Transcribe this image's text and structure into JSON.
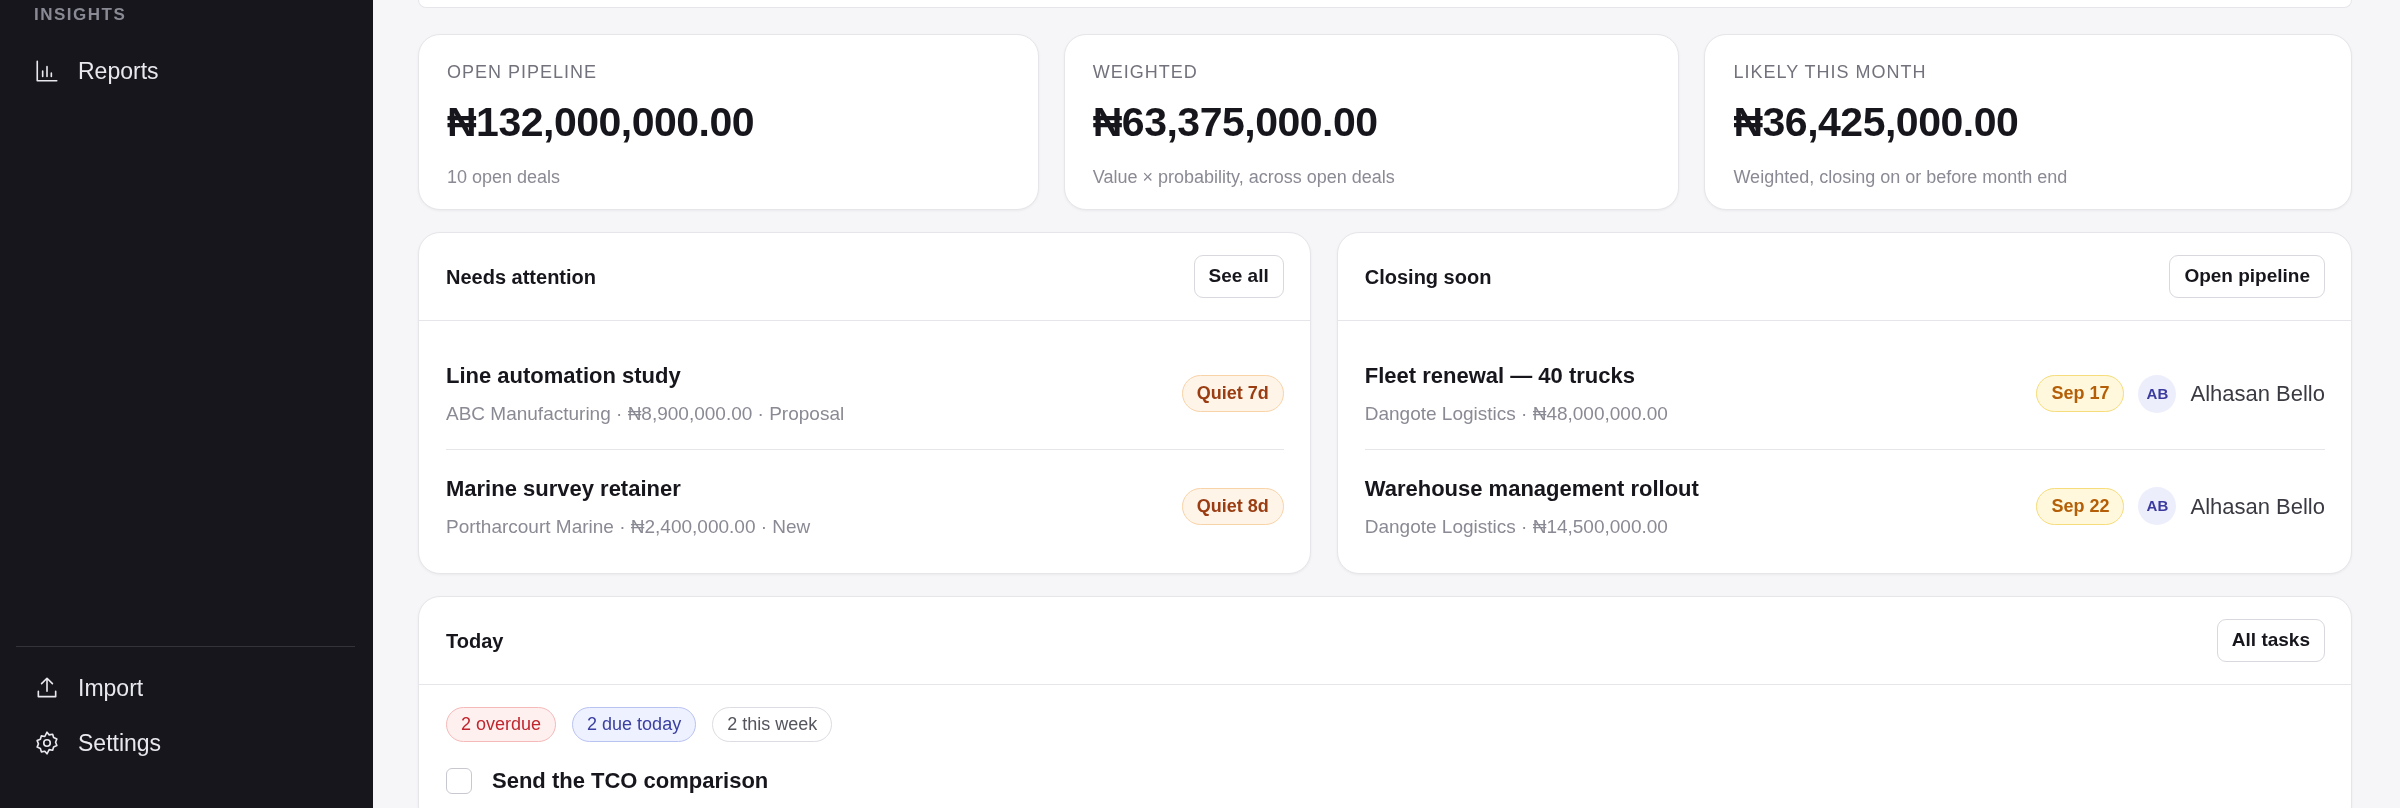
{
  "sidebar": {
    "section_label": "INSIGHTS",
    "items": [
      {
        "label": "Reports",
        "kind": "chart"
      }
    ],
    "footer_items": [
      {
        "label": "Import",
        "kind": "upload"
      },
      {
        "label": "Settings",
        "kind": "gear"
      }
    ]
  },
  "kpis": [
    {
      "label": "OPEN PIPELINE",
      "value": "₦132,000,000.00",
      "caption": "10 open deals"
    },
    {
      "label": "WEIGHTED",
      "value": "₦63,375,000.00",
      "caption": "Value × probability, across open deals"
    },
    {
      "label": "LIKELY THIS MONTH",
      "value": "₦36,425,000.00",
      "caption": "Weighted, closing on or before month end"
    }
  ],
  "needs_attention": {
    "title": "Needs attention",
    "button": "See all",
    "items": [
      {
        "title": "Line automation study",
        "meta": "ABC Manufacturing · ₦8,900,000.00 · Proposal",
        "badge": "Quiet 7d"
      },
      {
        "title": "Marine survey retainer",
        "meta": "Portharcourt Marine · ₦2,400,000.00 · New",
        "badge": "Quiet 8d"
      }
    ]
  },
  "closing_soon": {
    "title": "Closing soon",
    "button": "Open pipeline",
    "items": [
      {
        "title": "Fleet renewal — 40 trucks",
        "meta": "Dangote Logistics · ₦48,000,000.00",
        "date": "Sep 17",
        "initials": "AB",
        "owner": "Alhasan Bello"
      },
      {
        "title": "Warehouse management rollout",
        "meta": "Dangote Logistics · ₦14,500,000.00",
        "date": "Sep 22",
        "initials": "AB",
        "owner": "Alhasan Bello"
      }
    ]
  },
  "today": {
    "title": "Today",
    "button": "All tasks",
    "filters": [
      {
        "label": "2 overdue",
        "kind": "overdue"
      },
      {
        "label": "2 due today",
        "kind": "today"
      },
      {
        "label": "2 this week",
        "kind": "week"
      }
    ],
    "tasks": [
      {
        "title": "Send the TCO comparison",
        "checked": false
      }
    ]
  }
}
